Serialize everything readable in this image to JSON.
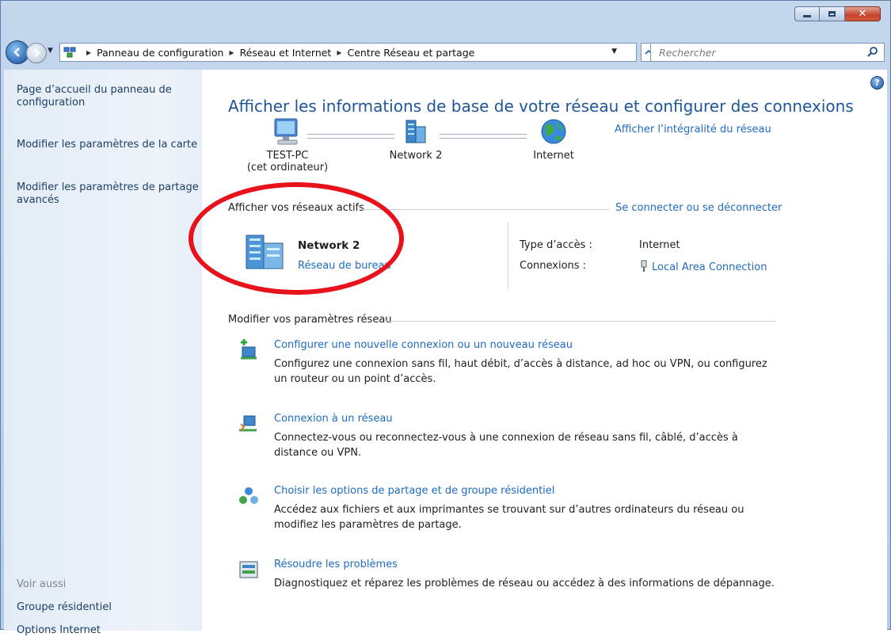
{
  "window": {
    "buttons": {
      "minimize": "minimize",
      "maximize": "maximize",
      "close": "close"
    }
  },
  "addressbar": {
    "crumbs": [
      "Panneau de configuration",
      "Réseau et Internet",
      "Centre Réseau et partage"
    ],
    "search_placeholder": "Rechercher"
  },
  "sidebar": {
    "links": [
      "Page d’accueil du panneau de configuration",
      "Modifier les paramètres de la carte",
      "Modifier les paramètres de partage avancés"
    ],
    "see_also_label": "Voir aussi",
    "see_also_links": [
      "Groupe résidentiel",
      "Options Internet"
    ]
  },
  "main": {
    "title": "Afficher les informations de base de votre réseau et configurer des connexions",
    "full_map_link": "Afficher l’intégralité du réseau",
    "map": {
      "computer_name": "TEST-PC",
      "computer_sub": "(cet ordinateur)",
      "network_name": "Network 2",
      "internet_name": "Internet"
    },
    "active_networks": {
      "heading": "Afficher vos réseaux actifs",
      "connect_link": "Se connecter ou se déconnecter",
      "network_name": "Network 2",
      "network_type": "Réseau de bureau",
      "access_type_label": "Type d’accès :",
      "access_type_value": "Internet",
      "connections_label": "Connexions :",
      "connections_value": "Local Area Connection"
    },
    "change_settings": {
      "heading": "Modifier vos paramètres réseau",
      "tasks": [
        {
          "link": "Configurer une nouvelle connexion ou un nouveau réseau",
          "desc": "Configurez une connexion sans fil, haut débit, d’accès à distance, ad hoc ou VPN, ou configurez un routeur ou un point d’accès."
        },
        {
          "link": "Connexion à un réseau",
          "desc": "Connectez-vous ou reconnectez-vous à une connexion de réseau sans fil, câblé, d’accès à distance ou VPN."
        },
        {
          "link": "Choisir les options de partage et de groupe résidentiel",
          "desc": "Accédez aux fichiers et aux imprimantes se trouvant sur d’autres ordinateurs du réseau ou modifiez les paramètres de partage."
        },
        {
          "link": "Résoudre les problèmes",
          "desc": "Diagnostiquez et réparez les problèmes de réseau ou accédez à des informations de dépannage."
        }
      ]
    }
  },
  "colors": {
    "link": "#1e6bc0",
    "title": "#1e5699",
    "annotation": "#e8121b"
  }
}
